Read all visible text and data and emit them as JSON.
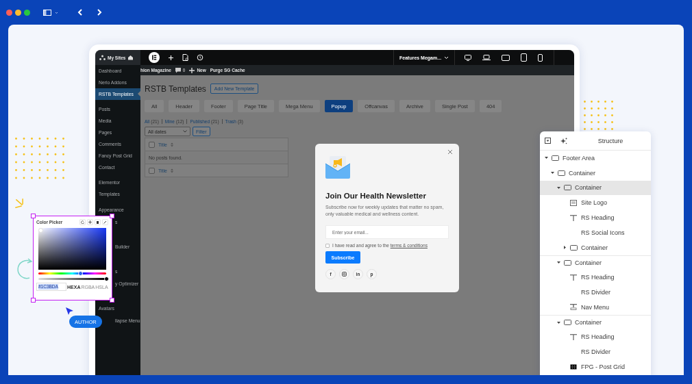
{
  "editor_bar": {
    "site_label": "My Sites",
    "document": "Features Megam..."
  },
  "admin_bar": {
    "site": "hion Magazine",
    "comments": "0",
    "new": "New",
    "purge": "Purge SG Cache"
  },
  "sidebar": {
    "groups": [
      [
        {
          "label": "Dashboard",
          "kind": "item",
          "selected": false
        },
        {
          "label": "Nerio Addons",
          "kind": "item",
          "selected": false
        },
        {
          "label": "RSTB Templates",
          "kind": "item",
          "selected": true
        }
      ],
      [
        {
          "label": "Posts",
          "kind": "item",
          "selected": false
        },
        {
          "label": "Media",
          "kind": "item",
          "selected": false
        },
        {
          "label": "Pages",
          "kind": "item",
          "selected": false
        },
        {
          "label": "Comments",
          "kind": "item",
          "selected": false
        },
        {
          "label": "Fancy Post Grid",
          "kind": "item",
          "selected": false
        },
        {
          "label": "Contact",
          "kind": "item",
          "selected": false
        }
      ],
      [
        {
          "label": "Elementor",
          "kind": "item",
          "selected": false
        },
        {
          "label": "Templates",
          "kind": "item",
          "selected": false
        }
      ],
      [
        {
          "label": "Appearance",
          "kind": "item",
          "selected": false
        },
        {
          "label": "s",
          "kind": "partial",
          "selected": false
        },
        {
          "kind": "covered",
          "selected": false
        },
        {
          "label": "Builder",
          "kind": "partial",
          "selected": false
        },
        {
          "kind": "covered",
          "selected": false
        },
        {
          "label": "s",
          "kind": "partial",
          "selected": false
        },
        {
          "label": "y Optimizer",
          "kind": "partial",
          "selected": false
        },
        {
          "kind": "covered",
          "selected": false
        },
        {
          "label": "Avatars",
          "kind": "item",
          "selected": false
        },
        {
          "label": "llapse Menu",
          "kind": "partial",
          "selected": false
        }
      ]
    ]
  },
  "page": {
    "title": "RSTB Templates",
    "add_button": "Add New Template",
    "tabs": [
      {
        "label": "All",
        "selected": false
      },
      {
        "label": "Header",
        "selected": false
      },
      {
        "label": "Footer",
        "selected": false
      },
      {
        "label": "Page Title",
        "selected": false
      },
      {
        "label": "Mega Menu",
        "selected": false
      },
      {
        "label": "Popup",
        "selected": true
      },
      {
        "label": "Offcanvas",
        "selected": false
      },
      {
        "label": "Archive",
        "selected": false
      },
      {
        "label": "Single Post",
        "selected": false
      },
      {
        "label": "404",
        "selected": false
      }
    ],
    "filters": [
      {
        "label": "All",
        "count": "(21)"
      },
      {
        "label": "Mine",
        "count": "(12)"
      },
      {
        "label": "Published",
        "count": "(21)"
      },
      {
        "label": "Trash",
        "count": "(3)"
      }
    ],
    "date_filter": "All dates",
    "filter_button": "Filter",
    "table": {
      "header": {
        "label": "Title",
        "checked": false
      },
      "empty": "No posts found.",
      "footer": {
        "label": "Title",
        "checked": false
      }
    }
  },
  "popup": {
    "title": "Join Our Health Newsletter",
    "description": "Subscribe now for weekly updates that matter no spam, only valuable medical and wellness content.",
    "email_placeholder": "Enter your email...",
    "agree_checked": false,
    "agree_text": "I have read and agree to the ",
    "agree_link": "terms & conditions",
    "button": "Subscribe",
    "socials": [
      {
        "kind": "facebook",
        "glyph": "f"
      },
      {
        "kind": "instagram"
      },
      {
        "kind": "linkedin",
        "glyph": "in"
      },
      {
        "kind": "pinterest",
        "glyph": "p"
      }
    ]
  },
  "color_picker": {
    "title": "Color Picker",
    "hue": {
      "level": 0.62
    },
    "alpha": {
      "level": 1
    },
    "value": "#1C3BDA",
    "formats": [
      {
        "label": "HEXA",
        "selected": true
      },
      {
        "label": "RGBA",
        "selected": false
      },
      {
        "label": "HSLA",
        "selected": false
      }
    ]
  },
  "user_tag": "AUTHOR",
  "structure": {
    "title": "Structure",
    "tree": [
      {
        "label": "Footer Area",
        "kind": "container",
        "expanded": true,
        "selected": false,
        "children": [
          {
            "label": "Container",
            "kind": "container",
            "expanded": true,
            "selected": false,
            "children": [
              {
                "label": "Container",
                "kind": "container",
                "expanded": true,
                "selected": true,
                "children": [
                  {
                    "label": "Site Logo",
                    "kind": "logo",
                    "selected": false
                  },
                  {
                    "label": "RS Heading",
                    "kind": "heading",
                    "selected": false
                  },
                  {
                    "label": "RS Social Icons",
                    "kind": "widget",
                    "selected": false
                  },
                  {
                    "label": "Container",
                    "kind": "container",
                    "expanded": false,
                    "selected": false
                  }
                ]
              },
              {
                "label": "Container",
                "kind": "container",
                "expanded": true,
                "selected": false,
                "children": [
                  {
                    "label": "RS Heading",
                    "kind": "heading",
                    "selected": false
                  },
                  {
                    "label": "RS Divider",
                    "kind": "widget",
                    "selected": false
                  },
                  {
                    "label": "Nav Menu",
                    "kind": "nav",
                    "selected": false
                  }
                ]
              },
              {
                "label": "Container",
                "kind": "container",
                "expanded": true,
                "selected": false,
                "children": [
                  {
                    "label": "RS Heading",
                    "kind": "heading",
                    "selected": false
                  },
                  {
                    "label": "RS Divider",
                    "kind": "widget",
                    "selected": false
                  },
                  {
                    "label": "FPG - Post Grid",
                    "kind": "grid",
                    "selected": false
                  }
                ]
              }
            ]
          }
        ]
      }
    ]
  }
}
